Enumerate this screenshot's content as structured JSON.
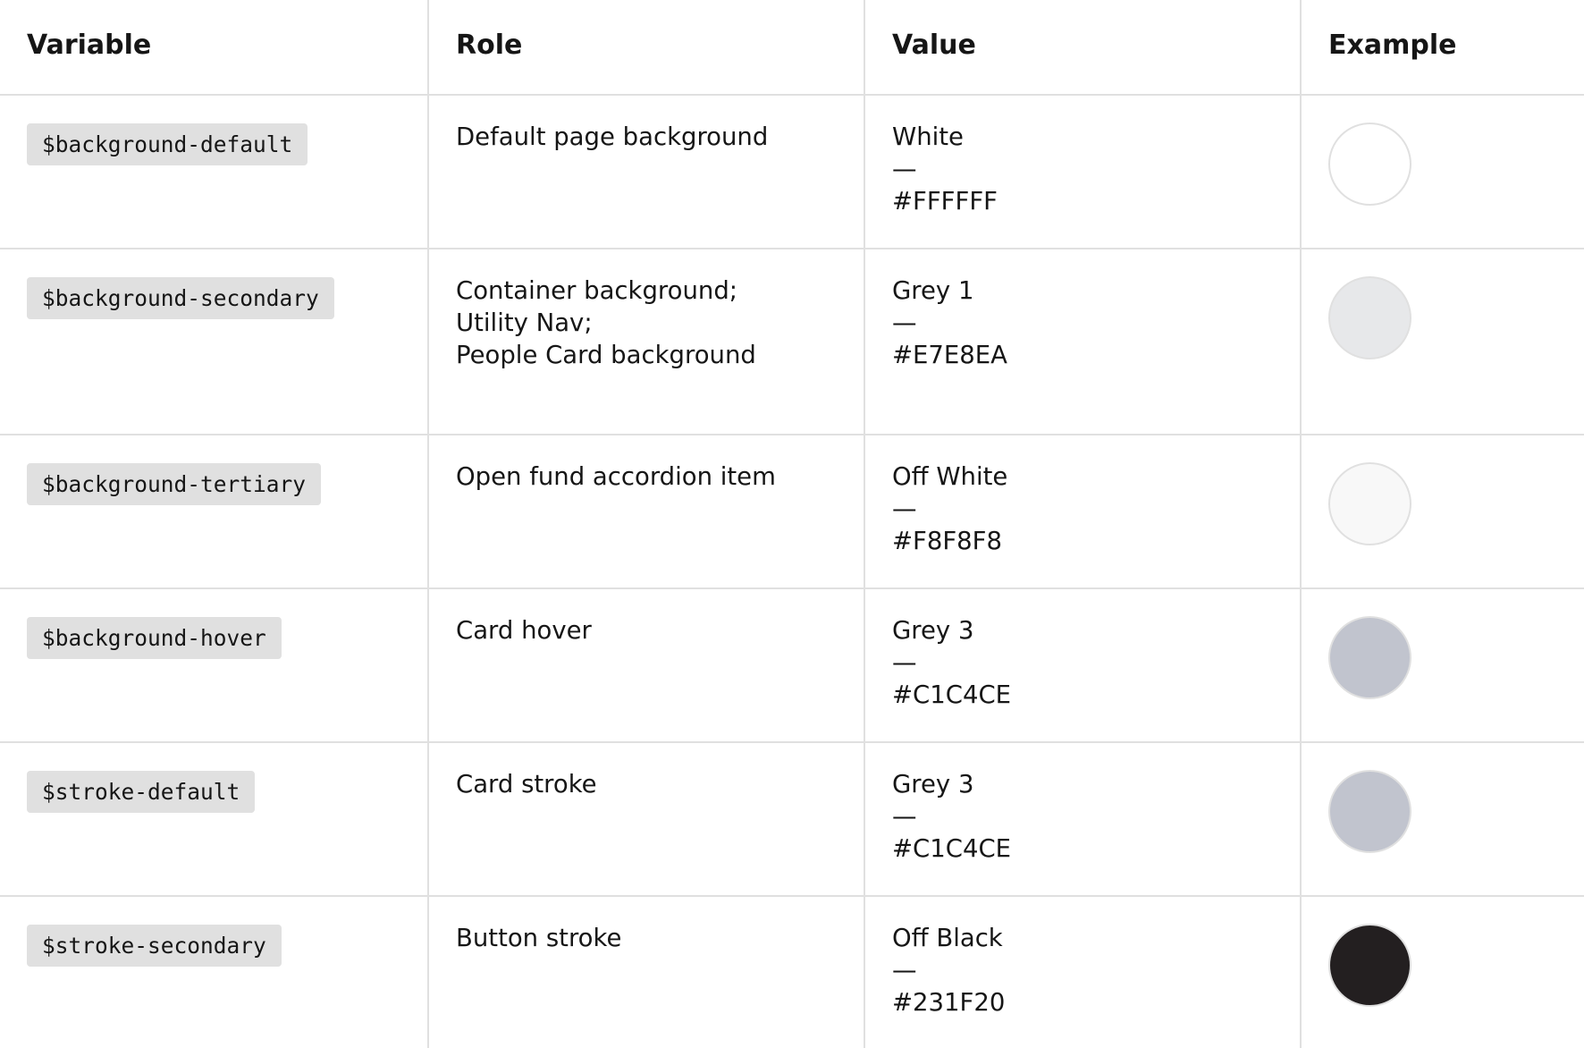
{
  "header": {
    "variable": "Variable",
    "role": "Role",
    "value": "Value",
    "example": "Example"
  },
  "rows": [
    {
      "variable": "$background-default",
      "role": [
        "Default page background"
      ],
      "value_name": "White",
      "dash": "—",
      "hex": "#FFFFFF",
      "color": "#FFFFFF"
    },
    {
      "variable": "$background-secondary",
      "role": [
        "Container background;",
        "Utility Nav;",
        "People Card background"
      ],
      "value_name": "Grey 1",
      "dash": "—",
      "hex": "#E7E8EA",
      "color": "#E7E8EA"
    },
    {
      "variable": "$background-tertiary",
      "role": [
        "Open fund accordion item"
      ],
      "value_name": "Off White",
      "dash": "—",
      "hex": "#F8F8F8",
      "color": "#F8F8F8"
    },
    {
      "variable": "$background-hover",
      "role": [
        "Card hover"
      ],
      "value_name": "Grey 3",
      "dash": "—",
      "hex": "#C1C4CE",
      "color": "#C1C4CE"
    },
    {
      "variable": "$stroke-default",
      "role": [
        "Card stroke"
      ],
      "value_name": "Grey 3",
      "dash": "—",
      "hex": "#C1C4CE",
      "color": "#C1C4CE"
    },
    {
      "variable": "$stroke-secondary",
      "role": [
        "Button stroke"
      ],
      "value_name": "Off Black",
      "dash": "—",
      "hex": "#231F20",
      "color": "#231F20"
    }
  ]
}
